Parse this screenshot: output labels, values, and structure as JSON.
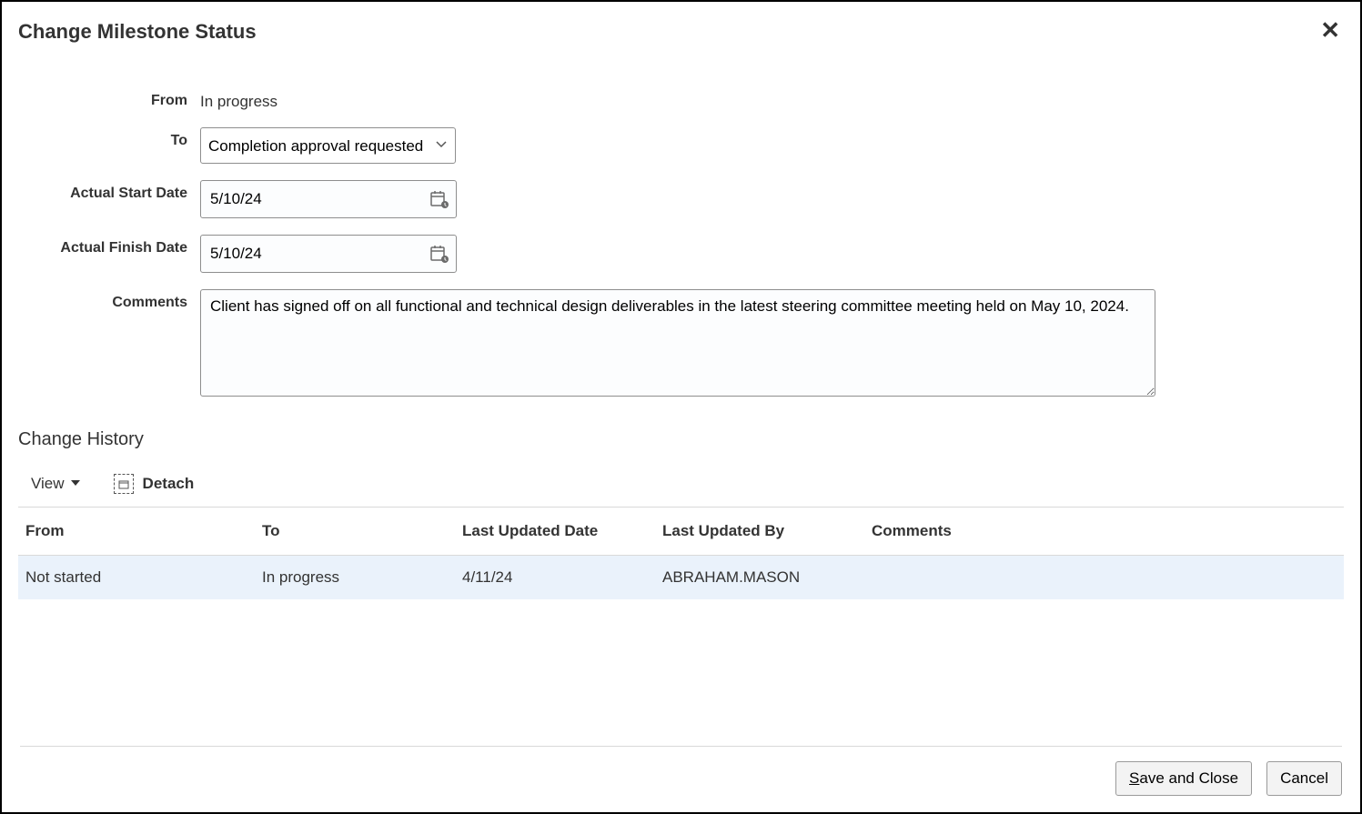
{
  "dialog": {
    "title": "Change Milestone Status",
    "labels": {
      "from": "From",
      "to": "To",
      "start": "Actual Start Date",
      "finish": "Actual Finish Date",
      "comments": "Comments"
    },
    "from_value": "In progress",
    "to_selected": "Completion approval requested",
    "start_date": "5/10/24",
    "finish_date": "5/10/24",
    "comments_value": "Client has signed off on all functional and technical design deliverables in the latest steering committee meeting held on May 10, 2024."
  },
  "history": {
    "title": "Change History",
    "toolbar": {
      "view": "View",
      "detach": "Detach"
    },
    "columns": {
      "from": "From",
      "to": "To",
      "updated_date": "Last Updated Date",
      "updated_by": "Last Updated By",
      "comments": "Comments"
    },
    "rows": [
      {
        "from": "Not started",
        "to": "In progress",
        "updated_date": "4/11/24",
        "updated_by": "ABRAHAM.MASON",
        "comments": ""
      }
    ]
  },
  "footer": {
    "save_close": "ave and Close",
    "save_close_key": "S",
    "cancel": "Cancel"
  }
}
